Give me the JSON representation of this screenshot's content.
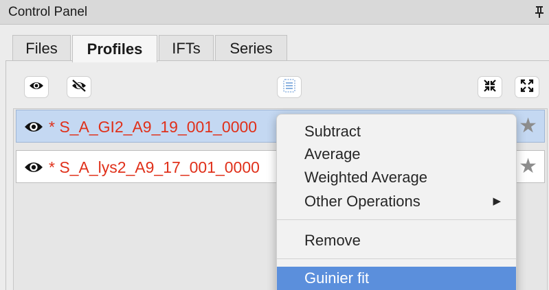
{
  "window": {
    "title": "Control Panel"
  },
  "tabs": [
    {
      "label": "Files",
      "active": false
    },
    {
      "label": "Profiles",
      "active": true
    },
    {
      "label": "IFTs",
      "active": false
    },
    {
      "label": "Series",
      "active": false
    }
  ],
  "toolbar": {
    "buttons": [
      {
        "icon": "eye-icon"
      },
      {
        "icon": "eye-slash-icon"
      },
      {
        "icon": "select-all-icon"
      },
      {
        "icon": "collapse-all-icon"
      },
      {
        "icon": "expand-all-icon"
      }
    ]
  },
  "profiles": [
    {
      "name": "* S_A_GI2_A9_19_001_0000",
      "selected": true,
      "visible": true
    },
    {
      "name": "* S_A_lys2_A9_17_001_0000",
      "selected": false,
      "visible": true
    }
  ],
  "context_menu": {
    "groups": [
      {
        "items": [
          {
            "label": "Subtract"
          },
          {
            "label": "Average"
          },
          {
            "label": "Weighted Average"
          },
          {
            "label": "Other Operations",
            "submenu_arrow": "▶"
          }
        ]
      },
      {
        "items": [
          {
            "label": "Remove"
          }
        ]
      },
      {
        "items": [
          {
            "label": "Guinier fit",
            "highlighted": true
          }
        ]
      }
    ]
  },
  "colors": {
    "profile_text": "#e0301a",
    "selected_row": "#c4d8f2",
    "menu_highlight": "#5b8fdc"
  }
}
